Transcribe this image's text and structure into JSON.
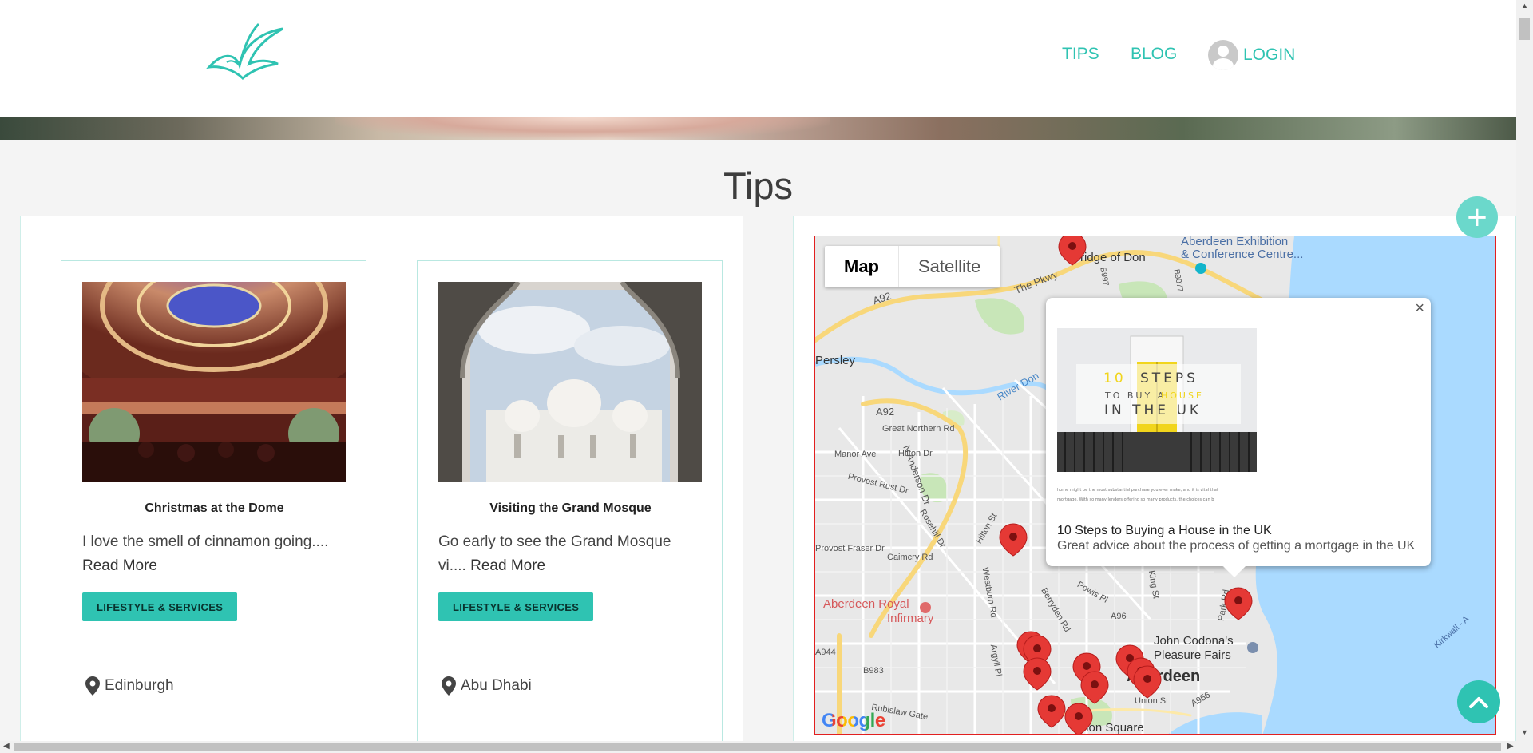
{
  "header": {
    "nav": {
      "tips": "TIPS",
      "blog": "BLOG",
      "login": "LOGIN"
    }
  },
  "page": {
    "title": "Tips"
  },
  "cards": [
    {
      "title": "Christmas at the Dome",
      "excerpt": "I love the smell of cinnamon going....",
      "read_more": "Read More",
      "tag": "LIFESTYLE & SERVICES",
      "location": "Edinburgh"
    },
    {
      "title": "Visiting the Grand Mosque",
      "excerpt": "Go early to see the Grand Mosque vi....",
      "read_more": "Read More",
      "tag": "LIFESTYLE & SERVICES",
      "location": "Abu Dhabi"
    }
  ],
  "map": {
    "type_map": "Map",
    "type_satellite": "Satellite",
    "labels": {
      "exhibition": "Aberdeen Exhibition",
      "conference": "& Conference Centre...",
      "bridge": "Bridge of Don",
      "pkwy": "The Pkwy",
      "a92a": "A92",
      "a92b": "A92",
      "persley": "Persley",
      "river": "River Don",
      "northern": "Great Northern Rd",
      "manor": "Manor Ave",
      "hilton_dr": "Hilton Dr",
      "provost": "Provost Rust Dr",
      "anderson": "N Anderson Dr",
      "fraser": "Provost Fraser Dr",
      "rosehill": "Rosehill Dr",
      "hilton_st": "Hilton St",
      "caimcry": "Caimcry Rd",
      "infirmary1": "Aberdeen Royal",
      "infirmary2": "Infirmary",
      "westburn": "Westburn Rd",
      "berryden": "Berryden Rd",
      "powis": "Powis Pl",
      "king": "King St",
      "park": "Park Rd",
      "a96": "A96",
      "codona1": "John Codona's",
      "codona2": "Pleasure Fairs",
      "aberdeen": "Aberdeen",
      "b983": "B983",
      "a944": "A944",
      "argyll": "Argyll Pl",
      "union": "Union St",
      "a956": "A956",
      "union_square": "Union Square",
      "gate": "Rubislaw Gate",
      "kirkwall": "Kirkwall - A",
      "b997": "B997",
      "b9077": "B9077"
    },
    "google": "Google",
    "infowindow": {
      "close": "×",
      "image_steps_num": "10",
      "image_steps": "STEPS",
      "image_line2a": "TO BUY A",
      "image_line2b": "HOUSE",
      "image_line3": "IN THE UK",
      "image_caption1": "home might be the most substantial purchase you ever make, and it is vital that",
      "image_caption2": "mortgage. With so many lenders offering so many products, the choices can b",
      "title": "10 Steps to Buying a House in the UK",
      "description": "Great advice about the process of getting a mortgage in the UK"
    }
  },
  "colors": {
    "accent": "#2fc3b2",
    "marker": "#e53935",
    "water": "#aadaff"
  },
  "icons": {
    "plus": "+",
    "up": "chevron-up-icon"
  }
}
